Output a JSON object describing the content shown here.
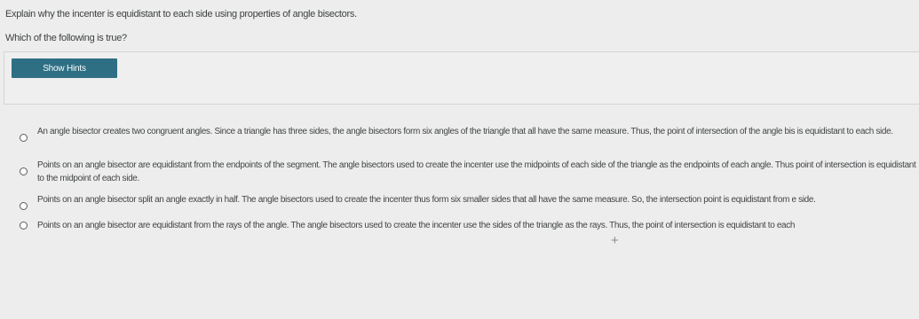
{
  "prompt": "Explain why the incenter is equidistant to each side using properties of angle bisectors.",
  "question": "Which of the following is true?",
  "hint_button": "Show Hints",
  "options": [
    {
      "text": "An angle bisector creates two congruent angles. Since a triangle has three sides, the angle bisectors form six angles of the triangle that all have the same measure. Thus, the point of intersection of the angle bis is equidistant to each side."
    },
    {
      "text": "Points on an angle bisector are equidistant from the endpoints of the segment. The angle bisectors used to create the incenter use the midpoints of each side of the triangle as the endpoints of each angle. Thus point of intersection is equidistant to the midpoint of each side."
    },
    {
      "text": "Points on an angle bisector split an angle exactly in half. The angle bisectors used to create the incenter thus form six smaller sides that all have the same measure. So, the intersection point is equidistant from e side."
    },
    {
      "text": "Points on an angle bisector are equidistant from the rays of the angle. The angle bisectors used to create the incenter use the sides of the triangle as the rays. Thus, the point of intersection is equidistant to each"
    }
  ],
  "cursor_symbol": "+"
}
